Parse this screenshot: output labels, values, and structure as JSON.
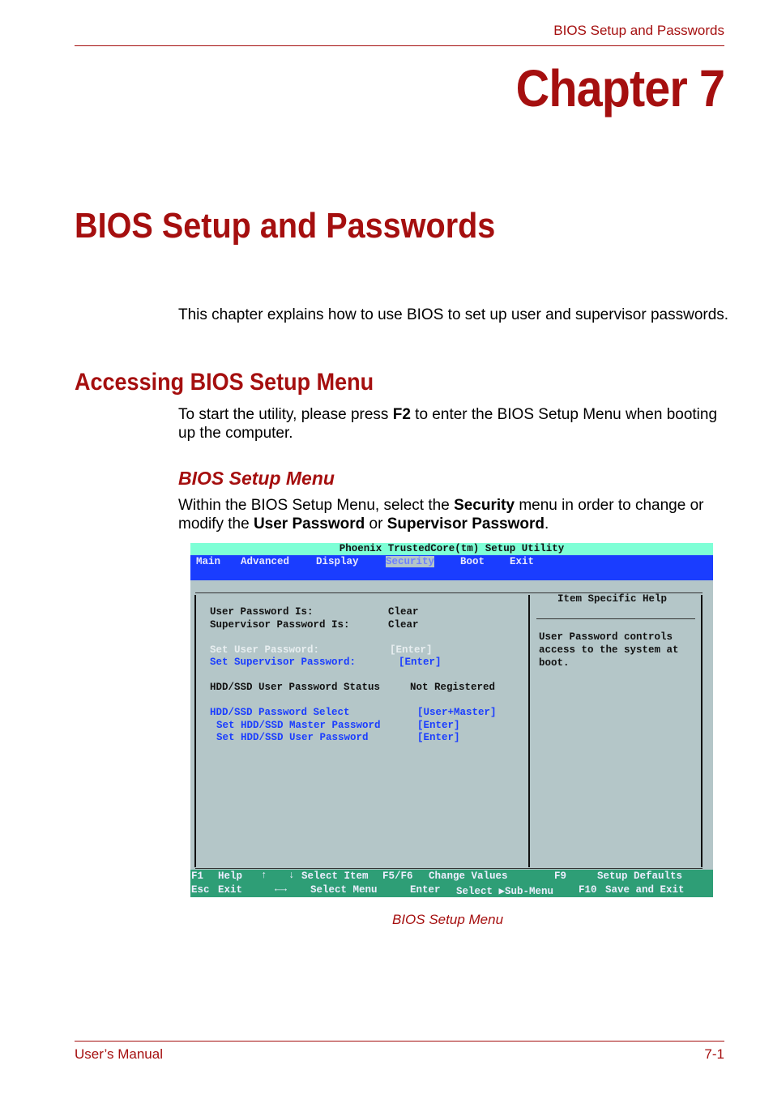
{
  "header": {
    "running_title": "BIOS Setup and Passwords",
    "chapter_label": "Chapter 7",
    "chapter_title": "BIOS Setup and Passwords"
  },
  "intro": {
    "text": "This chapter explains how to use BIOS to set up user and supervisor passwords."
  },
  "section": {
    "heading": "Accessing BIOS Setup Menu",
    "p_before": "To start the utility, please press ",
    "p_key": "F2",
    "p_after": " to enter the BIOS Setup Menu when booting up the computer."
  },
  "subsection": {
    "heading": "BIOS Setup Menu",
    "p1": "Within the BIOS Setup Menu, select the ",
    "p_bold1": "Security",
    "p2": " menu in order to change or modify the ",
    "p_bold2": "User Password",
    "p3": " or ",
    "p_bold3": "Supervisor Password",
    "p4": "."
  },
  "bios": {
    "title": "Phoenix TrustedCore(tm) Setup Utility",
    "menu": [
      "Main",
      "Advanced",
      "Display",
      "Security",
      "Boot",
      "Exit"
    ],
    "active_menu": "Security",
    "rows": {
      "user_pw_label": "User Password Is:",
      "user_pw_value": "Clear",
      "sup_pw_label": "Supervisor Password Is:",
      "sup_pw_value": "Clear",
      "set_user_label": "Set User Password:",
      "set_user_value": "[Enter]",
      "set_sup_label": "Set Supervisor Password:",
      "set_sup_value": "[Enter]",
      "hdd_status_label": "HDD/SSD User Password Status",
      "hdd_status_value": "Not Registered",
      "hdd_select_label": "HDD/SSD Password Select",
      "hdd_select_value": "[User+Master]",
      "hdd_master_label": "Set HDD/SSD Master Password",
      "hdd_master_value": "[Enter]",
      "hdd_user_label": "Set HDD/SSD User Password",
      "hdd_user_value": "[Enter]"
    },
    "help": {
      "title": "Item Specific Help",
      "line1": "User Password controls",
      "line2": "access to the system at",
      "line3": "boot."
    },
    "footer": {
      "f1_key": "F1",
      "f1_label": "Help",
      "up_arrow": "↑",
      "down_arrow": "↓",
      "select_item": "Select Item",
      "f5f6_key": "F5/F6",
      "change_values": "Change Values",
      "f9_key": "F9",
      "setup_defaults": "Setup Defaults",
      "esc_key": "Esc",
      "esc_label": "Exit",
      "lr_arrow": "←→",
      "select_menu": "Select Menu",
      "enter_key": "Enter",
      "select_submenu": "Select ▶Sub-Menu",
      "f10_key": "F10",
      "save_exit": "Save and Exit"
    }
  },
  "caption": "BIOS Setup Menu",
  "footer": {
    "left": "User’s Manual",
    "right": "7-1"
  }
}
